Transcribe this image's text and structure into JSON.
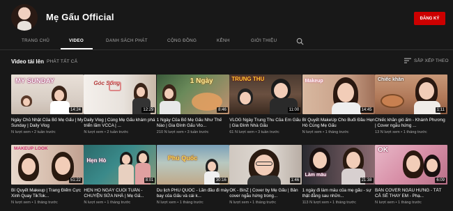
{
  "channel": {
    "name": "Mẹ Gấu Official",
    "subscribe_label": "ĐĂNG KÝ"
  },
  "tabs": [
    {
      "label": "TRANG CHỦ"
    },
    {
      "label": "VIDEO"
    },
    {
      "label": "DANH SÁCH PHÁT"
    },
    {
      "label": "CỘNG ĐỒNG"
    },
    {
      "label": "KÊNH"
    },
    {
      "label": "GIỚI THIỆU"
    }
  ],
  "section": {
    "title": "Video tải lên",
    "play_all": "PHÁT TẤT CẢ",
    "sort_label": "SẮP XẾP THEO"
  },
  "videos": [
    {
      "title": "Ngày Chủ Nhật Của Bố Mẹ Gấu | My Sunday | Daily Vlog",
      "meta": "N lượt xem • 2 tuần trước",
      "duration": "14:24",
      "caption": "MY SUNDAY"
    },
    {
      "title": "Daily Vlog | Cùng Mẹ Gấu khám phá triển lãm VCCA | ...",
      "meta": "N lượt xem • 2 tuần trước",
      "duration": "12:29",
      "caption": "Góc Sống"
    },
    {
      "title": "1 Ngày Của Bố Mẹ Gấu Như Thế Nào | Gia Đình Gấu Vlo...",
      "meta": "210 N lượt xem • 3 tuần trước",
      "duration": "8:46",
      "caption": "1 Ngày"
    },
    {
      "title": "VLOG Ngày Trung Thu Của Em Gấu | Gia Đình Nhà Gấu",
      "meta": "61 N lượt xem • 3 tuần trước",
      "duration": "11:00",
      "caption": "TRUNG THU"
    },
    {
      "title": "Bí Quyết MakeUp Cho Buổi Đầu Hẹn Hò Cùng Mẹ Gấu",
      "meta": "N lượt xem • 1 tháng trước",
      "duration": "14:45",
      "caption": "Makeup"
    },
    {
      "title": "Chiếc khăn gió ấm - Khánh Phương | Cover ngẫu hứng ...",
      "meta": "13 N lượt xem • 1 tháng trước",
      "duration": "1:11",
      "caption": "Chiếc khăn"
    },
    {
      "title": "Bí Quyết Makeup | Trang Điểm Cực Xinh Quay TikTok...",
      "meta": "N lượt xem • 1 tháng trước",
      "duration": "51:22",
      "caption": "MAKEUP LOOK"
    },
    {
      "title": "HẸN HÒ NGÀY CUỐI TUẦN - CHUYỆN SỬA NHÀ | Mẹ Gấ...",
      "meta": "N lượt xem • 1 tháng trước",
      "duration": "8:01",
      "caption": "Hẹn Hò"
    },
    {
      "title": "Du lịch PHÚ QUỐC - Lần đầu đi máy bay của Gấu và cái k...",
      "meta": "N lượt xem • 1 tháng trước",
      "duration": "30:16",
      "caption": "Phú Quốc"
    },
    {
      "title": "OK - BinZ | Cover by Mẹ Gấu | Bản cover ngẫu hứng trong...",
      "meta": "N lượt xem • 1 tháng trước",
      "duration": "1:46",
      "caption": ""
    },
    {
      "title": "1 ngày đi làm mẫu của mẹ gấu - sự thật đằng sau nhữn...",
      "meta": "113 N lượt xem • 1 tháng trước",
      "duration": "21:38",
      "caption": "Làm mẫu"
    },
    {
      "title": "BẢN COVER NGẪU HỨNG - TẤT CẢ SẼ THAY EM - Phạ...",
      "meta": "N lượt xem • 1 tháng trước",
      "duration": "6:09",
      "caption": "OK"
    }
  ]
}
